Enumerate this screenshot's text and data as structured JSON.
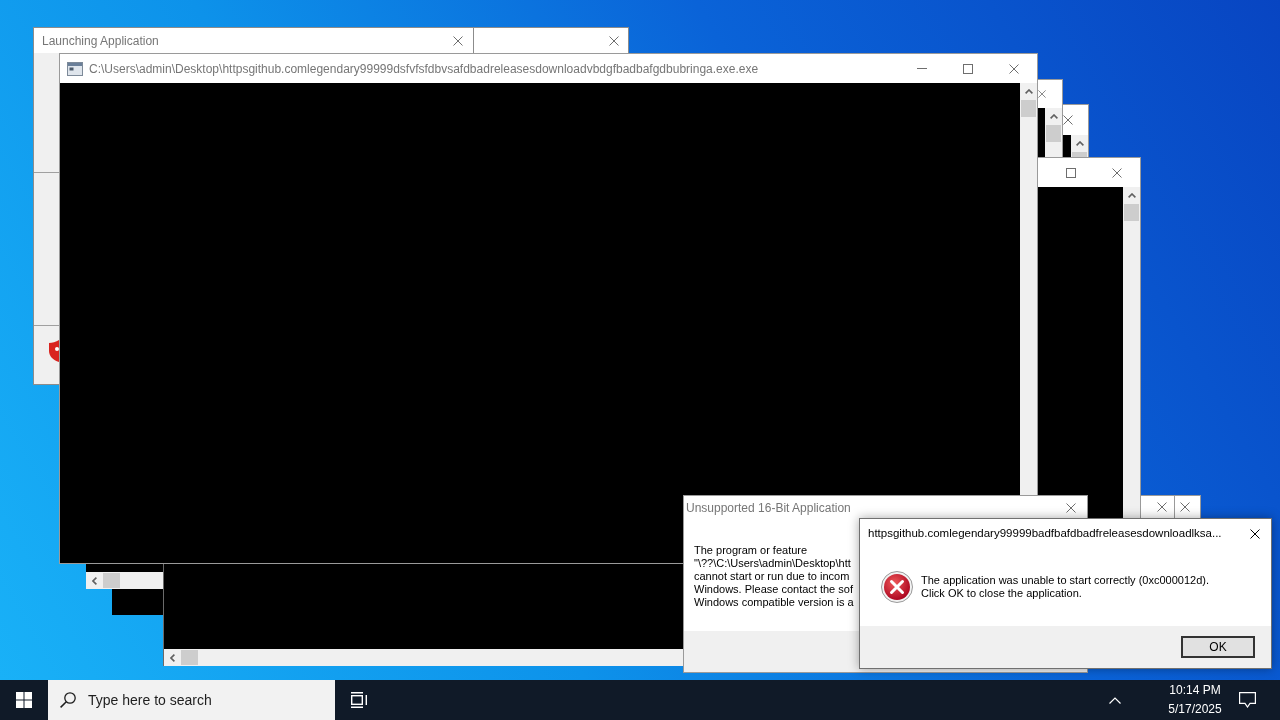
{
  "launching_window": {
    "title": "Launching Application",
    "active": false
  },
  "console_window": {
    "title": "C:\\Users\\admin\\Desktop\\httpsgithub.comlegendary99999dsfvfsfdbvsafdbadreleasesdownloadvbdgfbadbafgdbubringa.exe.exe",
    "active": false
  },
  "unsupported_dialog": {
    "title": "Unsupported 16-Bit Application",
    "active": false,
    "message_lines": [
      "The program or feature",
      "\"\\??\\C:\\Users\\admin\\Desktop\\htt",
      "cannot start or run due to incom",
      "Windows. Please contact the sof",
      "Windows compatible version is a"
    ]
  },
  "error_dialog": {
    "title": "httpsgithub.comlegendary99999badfbafdbadfreleasesdownloadlksa...",
    "active": true,
    "message_lines": [
      "The application was unable to start correctly (0xc000012d).",
      "Click OK to close the application."
    ],
    "buttons": [
      {
        "label": "OK",
        "default": true
      }
    ]
  },
  "taskbar": {
    "search": {
      "placeholder": "Type here to search"
    },
    "clock": {
      "time": "10:14 PM",
      "date": "5/17/2025"
    }
  }
}
